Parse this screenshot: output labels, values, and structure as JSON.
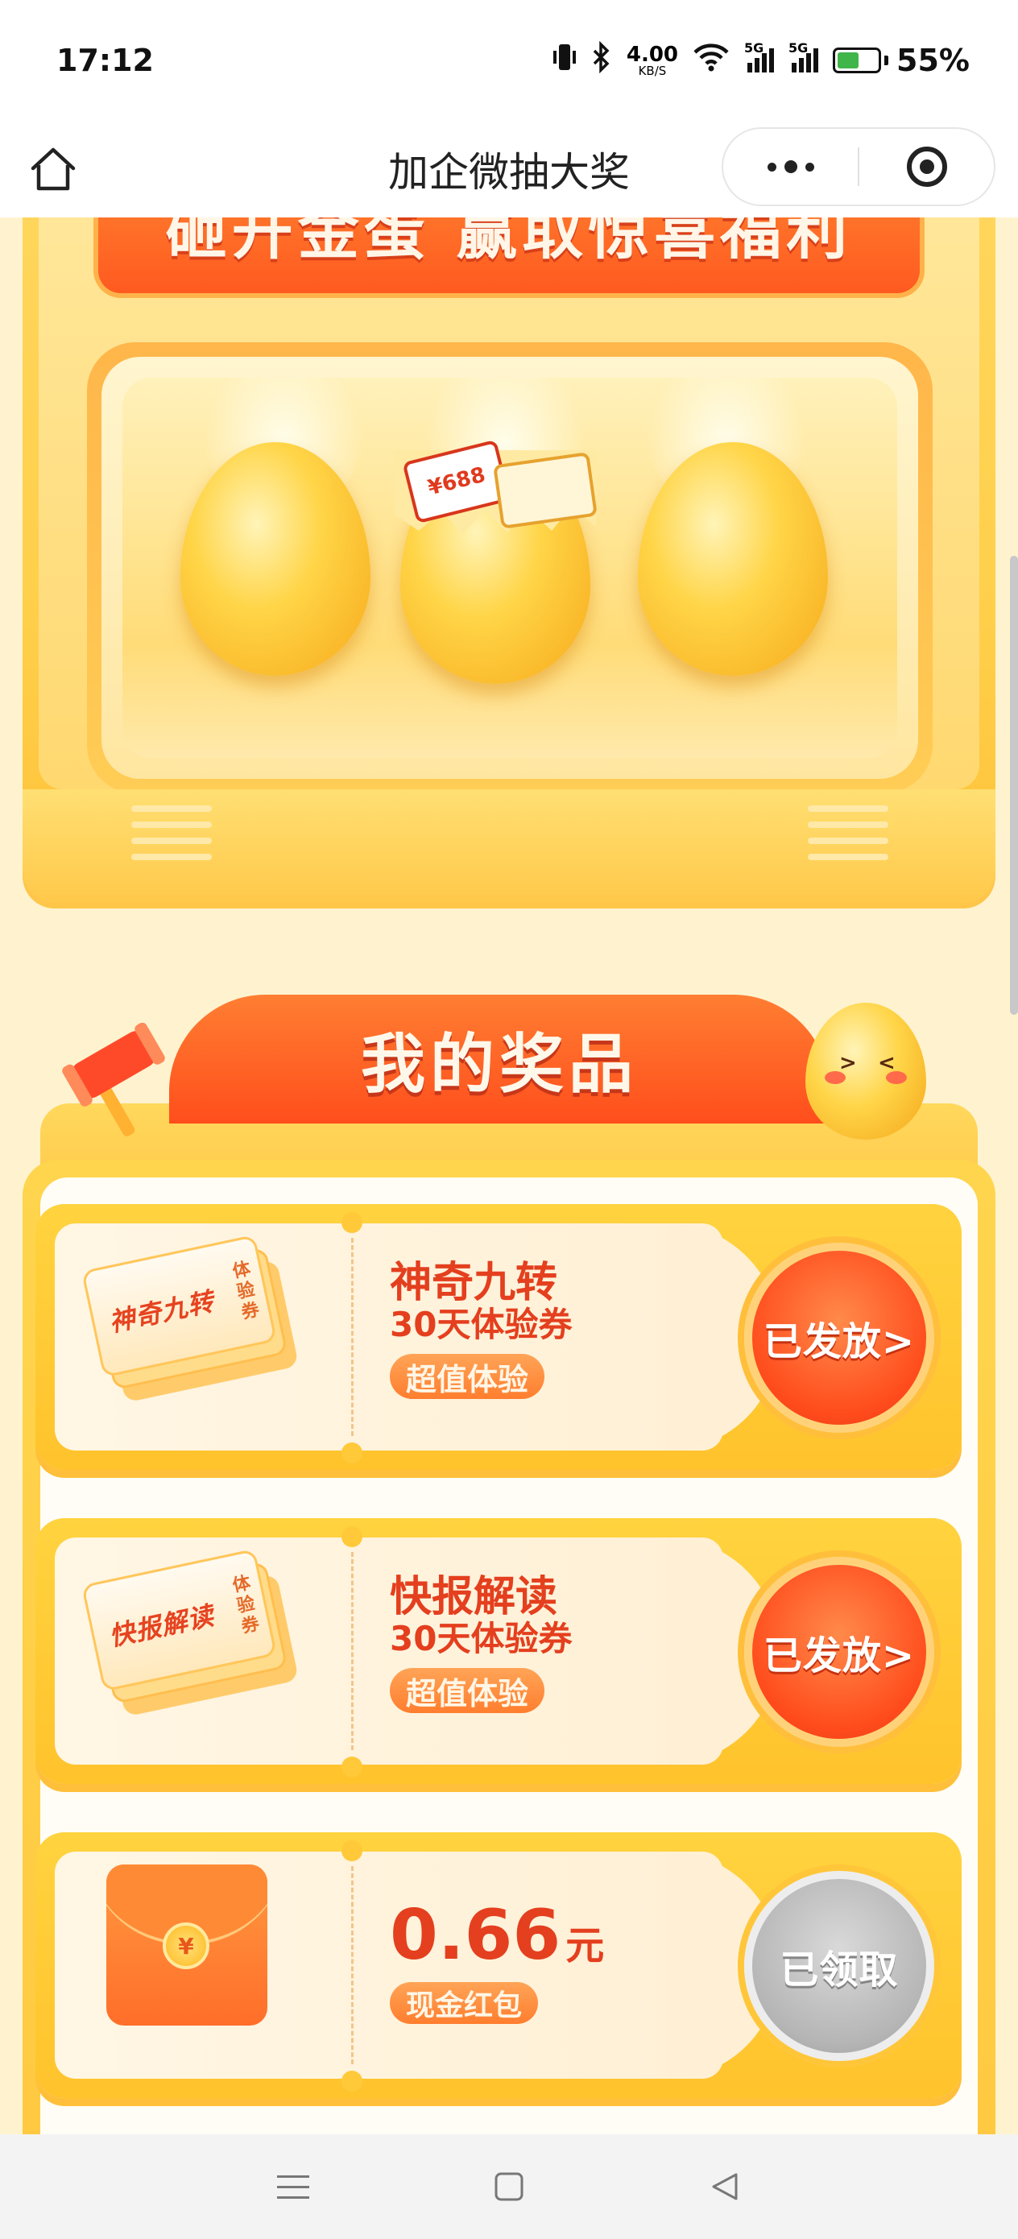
{
  "status_bar": {
    "time": "17:12",
    "net_speed_value": "4.00",
    "net_speed_unit": "KB/S",
    "signal1_tag": "5G",
    "signal2_tag": "5G",
    "battery_percent": "55%",
    "battery_level": 0.55,
    "battery_color": "#3fb54a"
  },
  "nav": {
    "title": "加企微抽大奖",
    "home_icon": "home-icon",
    "more_icon": "more-dots-icon",
    "close_icon": "target-close-icon"
  },
  "machine": {
    "banner_text": "砸开金蛋 赢取惊喜福利",
    "coupon_amount": "¥688"
  },
  "prizes": {
    "title": "我的奖品",
    "items": [
      {
        "ticket_label": "神奇九转",
        "ticket_stub": "体验券",
        "name": "神奇九转",
        "subtitle": "30天体验券",
        "tag": "超值体验",
        "status": "已发放>"
      },
      {
        "ticket_label": "快报解读",
        "ticket_stub": "体验券",
        "name": "快报解读",
        "subtitle": "30天体验券",
        "tag": "超值体验",
        "status": "已发放>"
      },
      {
        "coin_symbol": "¥",
        "amount": "0.66",
        "unit": "元",
        "tag": "现金红包",
        "status": "已领取"
      }
    ]
  },
  "colors": {
    "accent_orange": "#ff5a20",
    "gold": "#ffc940",
    "prize_text": "#e43f1e"
  }
}
